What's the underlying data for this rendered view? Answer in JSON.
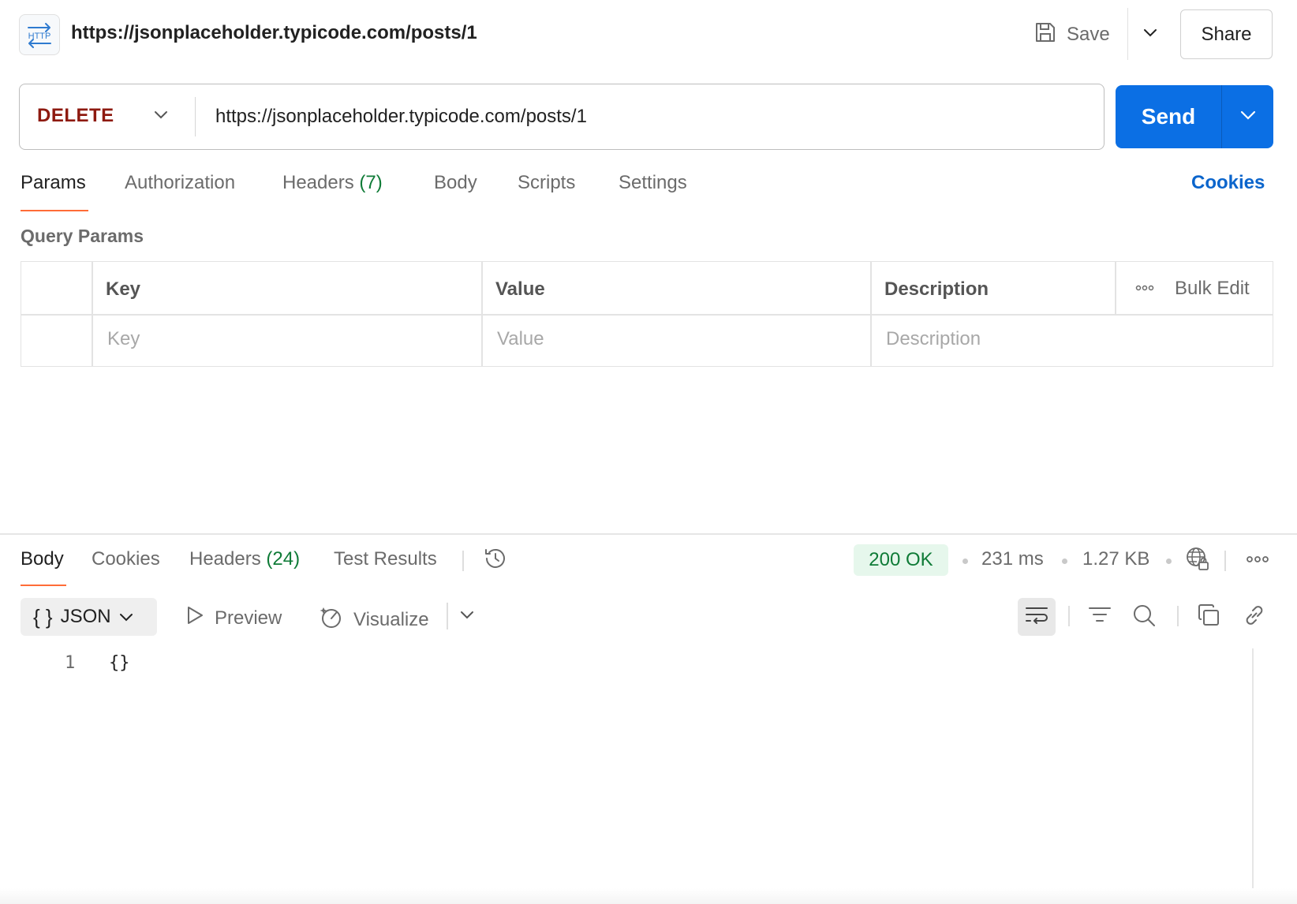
{
  "header": {
    "badge_text": "HTTP",
    "title": "https://jsonplaceholder.typicode.com/posts/1",
    "save_label": "Save",
    "share_label": "Share"
  },
  "request": {
    "method": "DELETE",
    "method_color": "#8e1a10",
    "url": "https://jsonplaceholder.typicode.com/posts/1",
    "send_label": "Send",
    "send_color": "#0b6fe4"
  },
  "request_tabs": {
    "params": "Params",
    "authorization": "Authorization",
    "headers": "Headers",
    "headers_count": "(7)",
    "body": "Body",
    "scripts": "Scripts",
    "settings": "Settings",
    "cookies": "Cookies",
    "active": "Params",
    "active_underline_color": "#ff6c37"
  },
  "params": {
    "section_title": "Query Params",
    "columns": {
      "key": "Key",
      "value": "Value",
      "description": "Description"
    },
    "bulk_edit": "Bulk Edit",
    "placeholders": {
      "key": "Key",
      "value": "Value",
      "description": "Description"
    }
  },
  "response_tabs": {
    "body": "Body",
    "cookies": "Cookies",
    "headers": "Headers",
    "headers_count": "(24)",
    "test_results": "Test Results",
    "active": "Body"
  },
  "response_meta": {
    "status": "200 OK",
    "status_color": "#0f7b37",
    "time": "231 ms",
    "size": "1.27 KB"
  },
  "response_toolbar": {
    "format": "JSON",
    "format_icon_text": "{ }",
    "preview": "Preview",
    "visualize": "Visualize"
  },
  "response_body": {
    "line_number": "1",
    "content": "{}"
  },
  "icons": {
    "save": "save-icon",
    "caret": "chevron-down-icon",
    "more": "more-horizontal-icon",
    "history": "history-icon",
    "network": "globe-lock-icon",
    "wrap": "wrap-lines-icon",
    "filter": "filter-icon",
    "search": "search-icon",
    "copy": "copy-icon",
    "link": "link-icon"
  }
}
